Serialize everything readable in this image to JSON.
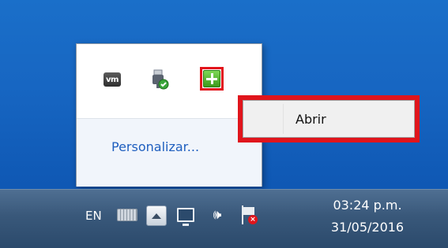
{
  "flyout": {
    "icons": [
      "vmware-icon",
      "usb-device-icon",
      "green-shield-app-icon"
    ],
    "vmware_glyph": "vm",
    "customize_link": "Personalizar..."
  },
  "context_menu": {
    "items": [
      {
        "label": "Abrir"
      }
    ]
  },
  "taskbar": {
    "language": "EN",
    "tray_icons": [
      "keyboard-icon",
      "show-hidden-icons-button",
      "network-icon",
      "volume-icon",
      "action-center-flag-icon"
    ],
    "clock": {
      "time": "03:24 p.m.",
      "date": "31/05/2016"
    }
  },
  "colors": {
    "desktop": "#1766c2",
    "highlight_border": "#e0151c",
    "link": "#1f5fbf"
  }
}
